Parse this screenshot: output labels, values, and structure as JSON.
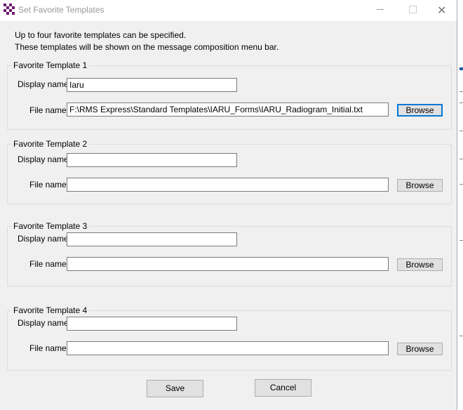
{
  "window": {
    "title": "Set Favorite Templates",
    "close_glyph": "✕"
  },
  "intro": {
    "line1": "Up to four favorite templates can be specified.",
    "line2": "These templates will be shown on the message composition menu bar."
  },
  "templates": [
    {
      "legend": "Favorite Template 1",
      "display_label": "Display name:",
      "display_value": "Iaru",
      "file_label": "File name:",
      "file_value": "F:\\RMS Express\\Standard Templates\\IARU_Forms\\IARU_Radiogram_Initial.txt",
      "browse_label": "Browse"
    },
    {
      "legend": "Favorite Template 2",
      "display_label": "Display name:",
      "display_value": "",
      "file_label": "File name:",
      "file_value": "",
      "browse_label": "Browse"
    },
    {
      "legend": "Favorite Template 3",
      "display_label": "Display name:",
      "display_value": "",
      "file_label": "File name:",
      "file_value": "",
      "browse_label": "Browse"
    },
    {
      "legend": "Favorite Template 4",
      "display_label": "Display name:",
      "display_value": "",
      "file_label": "File name:",
      "file_value": "",
      "browse_label": "Browse"
    }
  ],
  "buttons": {
    "save": "Save",
    "cancel": "Cancel"
  },
  "icons": {
    "app": "checkerboard-icon",
    "minimize": "minimize-icon",
    "maximize": "maximize-icon",
    "close": "close-icon"
  },
  "colors": {
    "accent": "#0078d7",
    "icon_purple": "#6a1b6b"
  }
}
